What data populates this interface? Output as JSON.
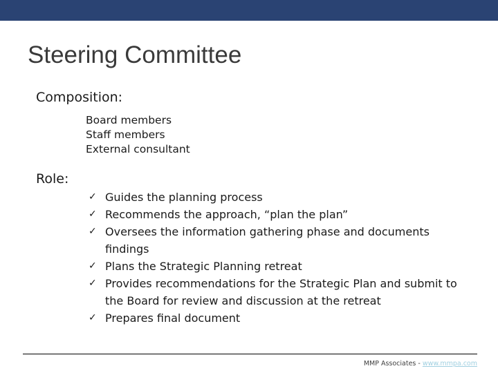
{
  "slide": {
    "title": "Steering Committee",
    "top_bar_color": "#2a4373",
    "title_color": "#3a3a3a"
  },
  "composition": {
    "heading": "Composition:",
    "items": [
      "Board members",
      "Staff members",
      "External consultant"
    ]
  },
  "role": {
    "heading": "Role:",
    "bullet_glyph": "✓",
    "items": [
      "Guides the planning process",
      "Recommends the approach, “plan the plan”",
      "Oversees the information gathering phase and documents findings",
      "Plans the Strategic Planning retreat",
      "Provides recommendations for the Strategic Plan and submit to the Board for review and discussion at the retreat",
      "Prepares final document"
    ]
  },
  "footer": {
    "credit": "MMP Associates - ",
    "link": "www.mmpa.com",
    "link_color": "#9fcfe0"
  }
}
